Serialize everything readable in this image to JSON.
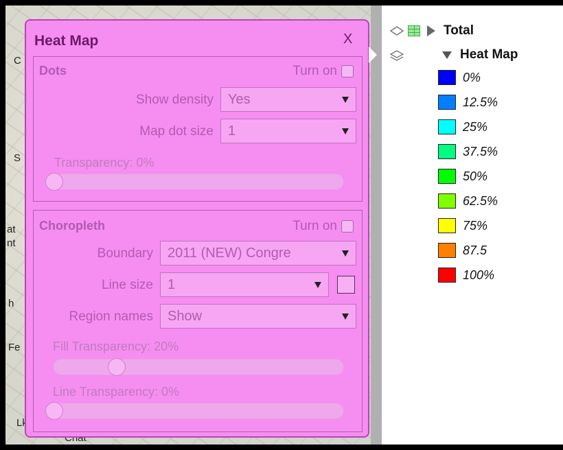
{
  "map": {
    "edge_letters": [
      "C",
      "S",
      "at",
      "nt",
      "h",
      "Fe",
      "Lk",
      "Chat"
    ]
  },
  "layers": {
    "total_label": "Total",
    "heatmap_label": "Heat Map",
    "legend": [
      {
        "label": "0%",
        "color": "#0000ff"
      },
      {
        "label": "12.5%",
        "color": "#0080ff"
      },
      {
        "label": "25%",
        "color": "#00ffff"
      },
      {
        "label": "37.5%",
        "color": "#00ff80"
      },
      {
        "label": "50%",
        "color": "#00ff00"
      },
      {
        "label": "62.5%",
        "color": "#80ff00"
      },
      {
        "label": "75%",
        "color": "#ffff00"
      },
      {
        "label": "87.5",
        "color": "#ff8000"
      },
      {
        "label": "100%",
        "color": "#ff0000"
      }
    ]
  },
  "dialog": {
    "title": "Heat Map",
    "close_label": "X",
    "dots": {
      "title": "Dots",
      "turn_on_label": "Turn on",
      "show_density_label": "Show density",
      "show_density_value": "Yes",
      "dot_size_label": "Map dot size",
      "dot_size_value": "1",
      "transparency_label": "Transparency:",
      "transparency_value": "0%",
      "transparency_level": 0
    },
    "choropleth": {
      "title": "Choropleth",
      "turn_on_label": "Turn on",
      "boundary_label": "Boundary",
      "boundary_value": "2011 (NEW) Congre",
      "line_size_label": "Line size",
      "line_size_value": "1",
      "region_names_label": "Region names",
      "region_names_value": "Show",
      "fill_transparency_label": "Fill Transparency:",
      "fill_transparency_value": "20%",
      "fill_transparency_level": 20,
      "line_transparency_label": "Line Transparency:",
      "line_transparency_value": "0%",
      "line_transparency_level": 0
    }
  }
}
